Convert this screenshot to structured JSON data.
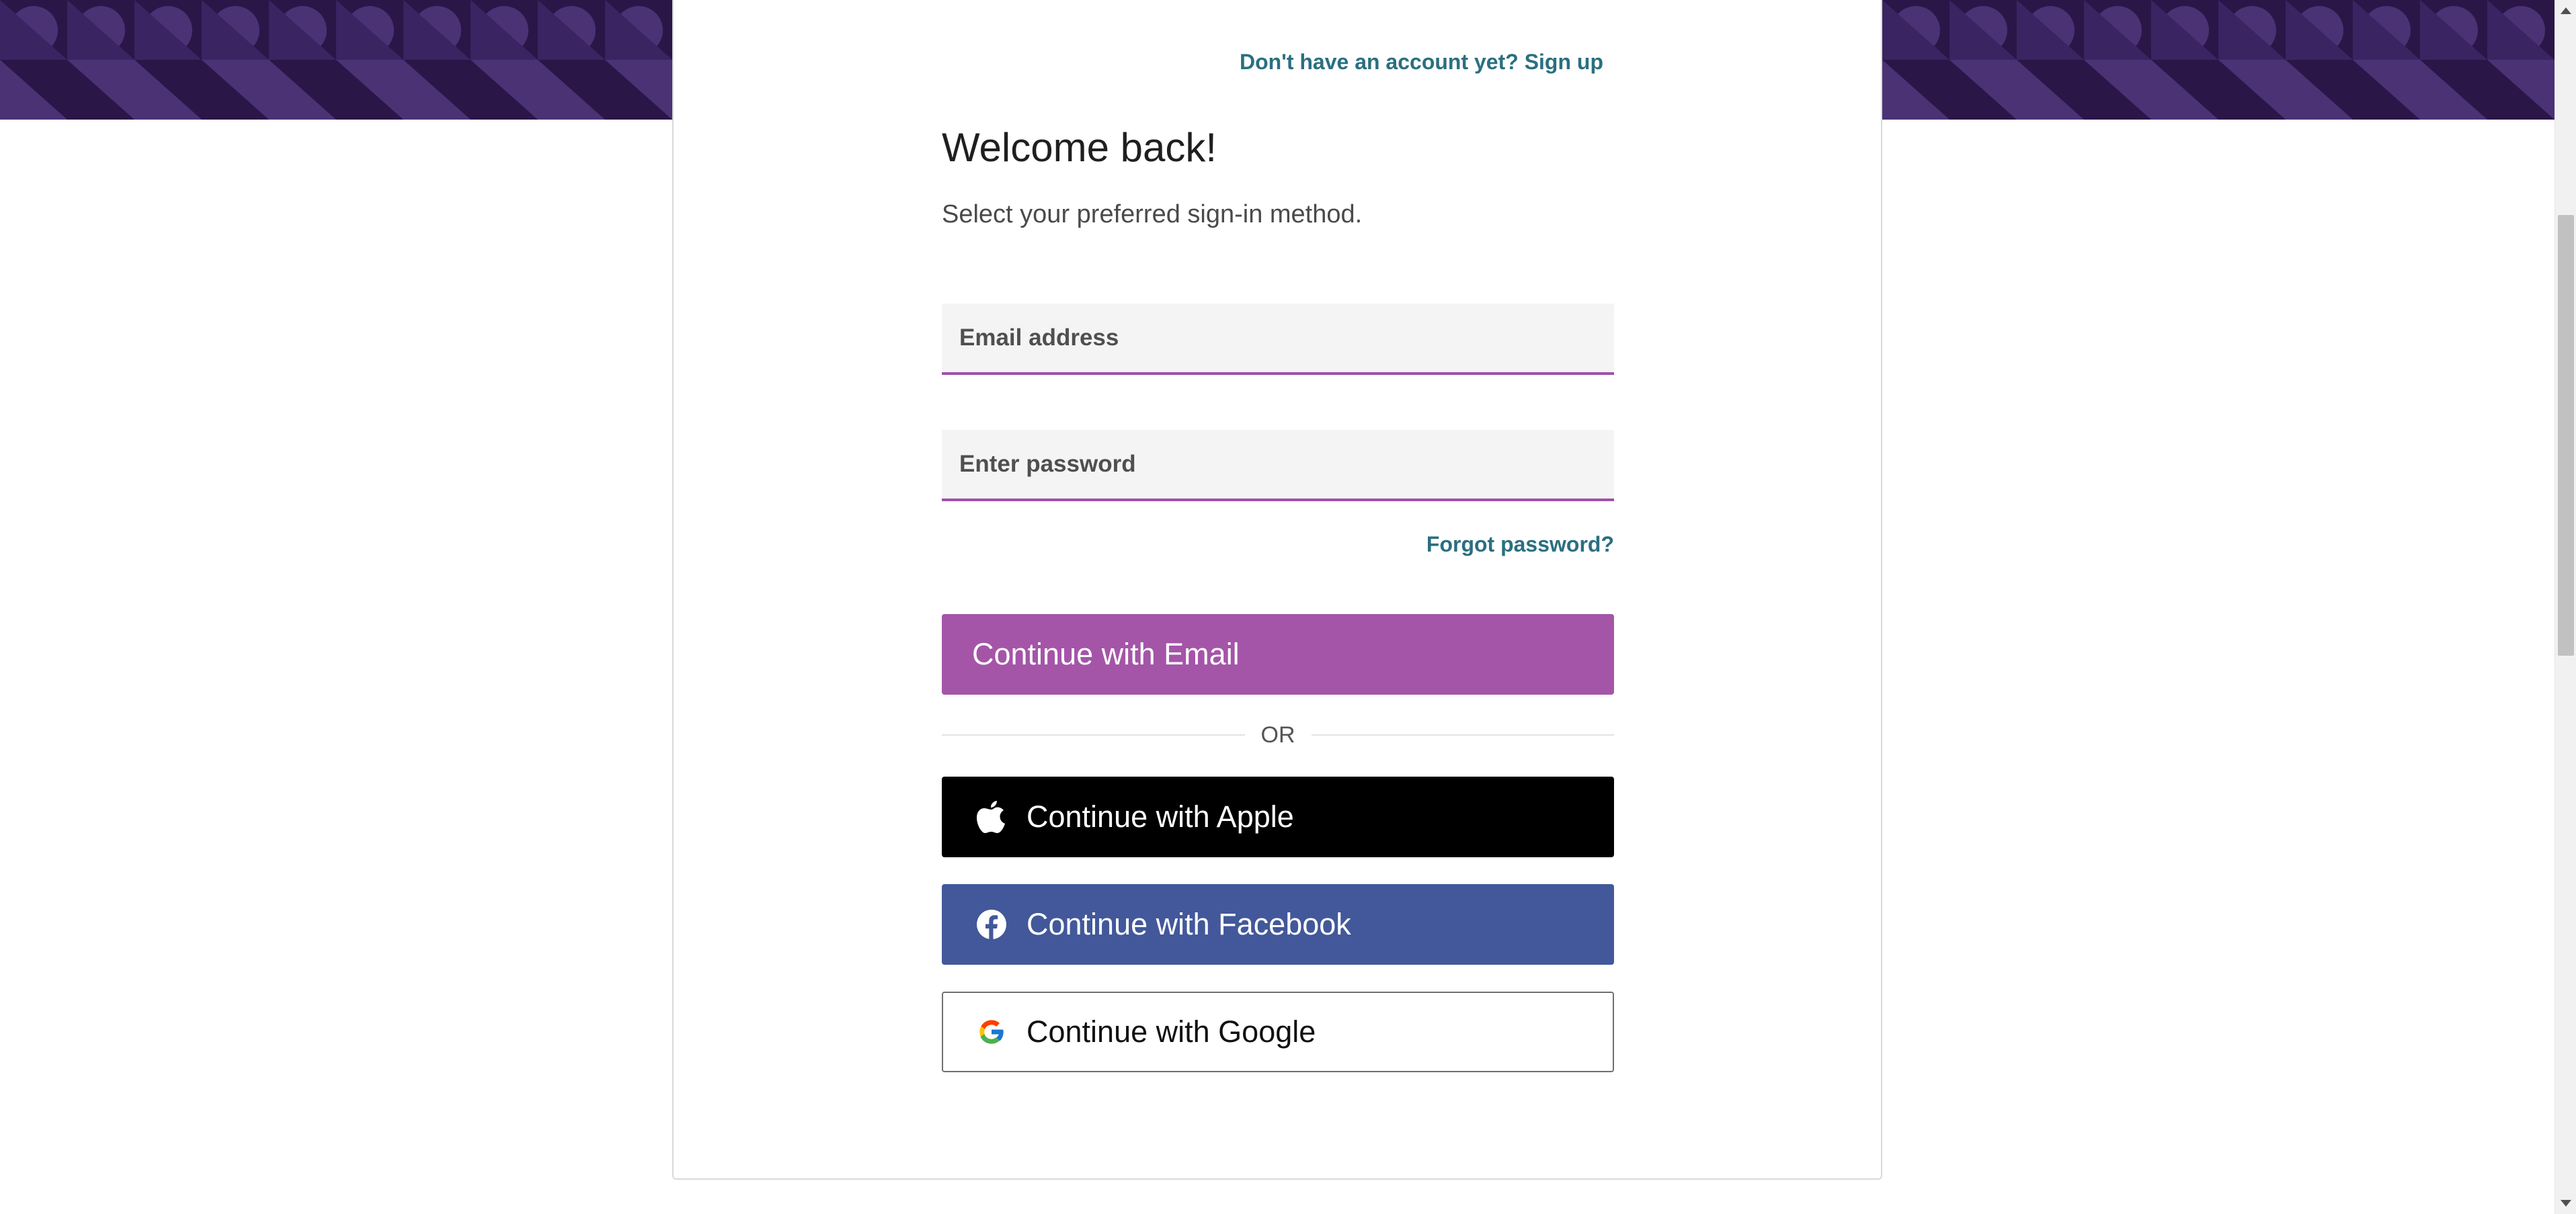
{
  "colors": {
    "accent": "#a455a8",
    "field_underline": "#a050ad",
    "link": "#2a6f80",
    "banner_bg": "#2b1648",
    "banner_shape": "#4a3275",
    "apple_bg": "#000000",
    "facebook_bg": "#42589a"
  },
  "header": {
    "signup_link": "Don't have an account yet? Sign up"
  },
  "form": {
    "title": "Welcome back!",
    "subtitle": "Select your preferred sign-in method.",
    "email": {
      "placeholder": "Email address",
      "value": ""
    },
    "password": {
      "placeholder": "Enter password",
      "value": ""
    },
    "forgot_link": "Forgot password?",
    "continue_email": "Continue with Email",
    "divider": "OR",
    "apple": {
      "label": "Continue with Apple",
      "icon": "apple-icon"
    },
    "facebook": {
      "label": "Continue with Facebook",
      "icon": "facebook-icon"
    },
    "google": {
      "label": "Continue with Google",
      "icon": "google-icon"
    }
  }
}
